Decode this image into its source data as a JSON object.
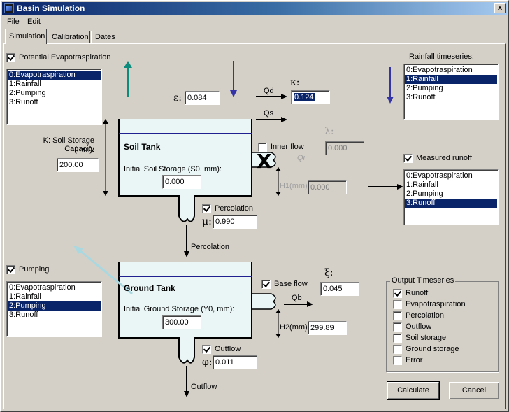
{
  "window": {
    "title": "Basin Simulation",
    "close_glyph": "x"
  },
  "menu": [
    "File",
    "Edit"
  ],
  "tabs": [
    "Simulation",
    "Calibration",
    "Dates"
  ],
  "left": {
    "pet_label": "Potential Evapotraspiration",
    "pet_list": [
      "0:Evapotraspiration",
      "1:Rainfall",
      "2:Pumping",
      "3:Runoff"
    ],
    "pet_selected": 0,
    "k_label_line1": "K: Soil Storage Capacity",
    "k_label_line2": "(mm):",
    "k_value": "200.00",
    "pumping_label": "Pumping",
    "pumping_list": [
      "0:Evapotraspiration",
      "1:Rainfall",
      "2:Pumping",
      "3:Runoff"
    ],
    "pumping_selected": 2
  },
  "soil": {
    "title": "Soil Tank",
    "init_label": "Initial Soil Storage (S0, mm):",
    "init_value": "0.000",
    "epsilon_symbol": "ε:",
    "epsilon_value": "0.084",
    "kappa_symbol": "κ:",
    "kappa_value": "0.124",
    "qd_label": "Qd",
    "qs_label": "Qs",
    "inner_flow_label": "Inner flow",
    "qi_label": "Qi",
    "lambda_symbol": "λ:",
    "lambda_value": "0.000",
    "h1_label": "H1(mm):",
    "h1_value": "0.000",
    "percolation_check_label": "Percolation",
    "mu_symbol": "μ:",
    "mu_value": "0.990",
    "percolation_flow_label": "Percolation",
    "inner_flow_disabled_mark": "X"
  },
  "ground": {
    "title": "Ground Tank",
    "init_label": "Initial Ground Storage (Y0, mm):",
    "init_value": "300.00",
    "base_flow_label": "Base flow",
    "xi_symbol": "ξ:",
    "xi_value": "0.045",
    "qb_label": "Qb",
    "h2_label": "H2(mm):",
    "h2_value": "299.89",
    "outflow_check_label": "Outflow",
    "phi_symbol": "φ:",
    "phi_value": "0.011",
    "outflow_flow_label": "Outflow"
  },
  "right": {
    "rainfall_label": "Rainfall timeseries:",
    "rainfall_list": [
      "0:Evapotraspiration",
      "1:Rainfall",
      "2:Pumping",
      "3:Runoff"
    ],
    "rainfall_selected": 1,
    "measured_label": "Measured runoff",
    "measured_list": [
      "0:Evapotraspiration",
      "1:Rainfall",
      "2:Pumping",
      "3:Runoff"
    ],
    "measured_selected": 3
  },
  "output": {
    "title": "Output Timeseries",
    "items": [
      {
        "label": "Runoff",
        "checked": true
      },
      {
        "label": "Evapotraspiration",
        "checked": false
      },
      {
        "label": "Percolation",
        "checked": false
      },
      {
        "label": "Outflow",
        "checked": false
      },
      {
        "label": "Soil storage",
        "checked": false
      },
      {
        "label": "Ground storage",
        "checked": false
      },
      {
        "label": "Error",
        "checked": false
      }
    ]
  },
  "buttons": {
    "calculate": "Calculate",
    "cancel": "Cancel"
  },
  "colors": {
    "arrow_blue": "#3434a8",
    "arrow_teal": "#0c8c7c",
    "arrow_lightblue": "#a9d8e0",
    "tank_fill": "#eaf5f5",
    "tank_water_line": "#202090"
  }
}
